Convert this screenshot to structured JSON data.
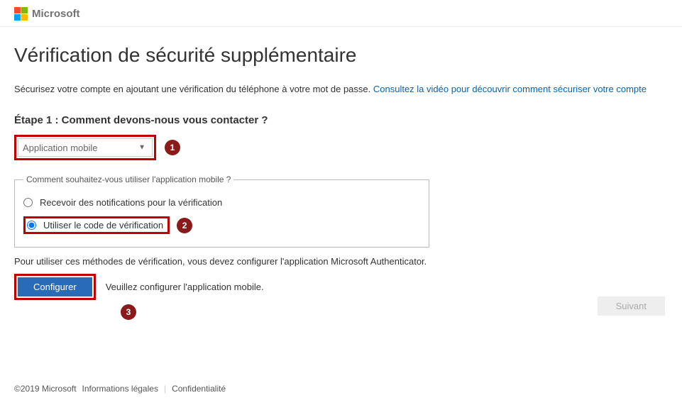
{
  "header": {
    "brand": "Microsoft"
  },
  "page": {
    "title": "Vérification de sécurité supplémentaire",
    "subtitle_prefix": "Sécurisez votre compte en ajoutant une vérification du téléphone à votre mot de passe. ",
    "subtitle_link": "Consultez la vidéo pour découvrir comment sécuriser votre compte"
  },
  "step": {
    "label": "Étape 1 : Comment devons-nous vous contacter ?",
    "dropdown_value": "Application mobile"
  },
  "usage": {
    "legend": "Comment souhaitez-vous utiliser l'application mobile ?",
    "option_notify": "Recevoir des notifications pour la vérification",
    "option_code": "Utiliser le code de vérification"
  },
  "configure": {
    "instruction": "Pour utiliser ces méthodes de vérification, vous devez configurer l'application Microsoft Authenticator.",
    "button": "Configurer",
    "hint": "Veuillez configurer l'application mobile."
  },
  "callouts": {
    "one": "1",
    "two": "2",
    "three": "3"
  },
  "next_button": "Suivant",
  "footer": {
    "copyright": "©2019 Microsoft",
    "legal": "Informations légales",
    "privacy": "Confidentialité"
  }
}
